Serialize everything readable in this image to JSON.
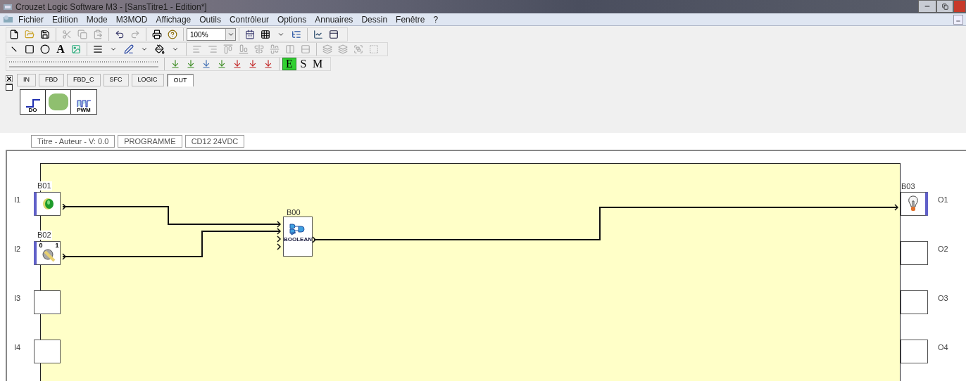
{
  "window": {
    "title": "Crouzet Logic Software M3 - [SansTitre1 - Edition*]"
  },
  "menu": [
    "Fichier",
    "Edition",
    "Mode",
    "M3MOD",
    "Affichage",
    "Outils",
    "Contrôleur",
    "Options",
    "Annuaires",
    "Dessin",
    "Fenêtre",
    "?"
  ],
  "toolbar": {
    "zoom": "100%",
    "text_tool": "A",
    "modes": [
      {
        "label": "E",
        "selected": true
      },
      {
        "label": "S",
        "selected": false
      },
      {
        "label": "M",
        "selected": false
      }
    ]
  },
  "palette": {
    "tabs": [
      {
        "label": "IN",
        "selected": false
      },
      {
        "label": "FBD",
        "selected": false
      },
      {
        "label": "FBD_C",
        "selected": false
      },
      {
        "label": "SFC",
        "selected": false
      },
      {
        "label": "LOGIC",
        "selected": false
      },
      {
        "label": "OUT",
        "selected": true
      }
    ],
    "items": [
      {
        "kind": "digital_output",
        "caption": "DO"
      },
      {
        "kind": "display"
      },
      {
        "kind": "pwm",
        "caption": "PWM"
      }
    ]
  },
  "status": [
    "Titre - Auteur - V: 0.0",
    "PROGRAMME",
    "CD12  24VDC"
  ],
  "diagram": {
    "inputs": [
      {
        "label": "I1",
        "block": "B01",
        "kind": "pushbutton"
      },
      {
        "label": "I2",
        "block": "B02",
        "kind": "switch",
        "marks": [
          "0",
          "1"
        ]
      },
      {
        "label": "I3",
        "kind": "empty"
      },
      {
        "label": "I4",
        "kind": "empty"
      }
    ],
    "function_block": {
      "name": "B00",
      "caption": "BOOLEAN"
    },
    "outputs": [
      {
        "label": "O1",
        "block": "B03",
        "kind": "lamp"
      },
      {
        "label": "O2",
        "kind": "empty"
      },
      {
        "label": "O3",
        "kind": "empty"
      },
      {
        "label": "O4",
        "kind": "empty"
      }
    ]
  }
}
